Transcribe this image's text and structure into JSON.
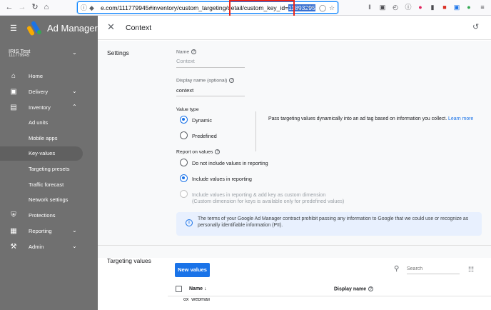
{
  "browser": {
    "url_prefix": "e.com/111779945#inventory/custom_targeting/detail/",
    "url_highlight_a": "custom_key_id=",
    "url_highlight_b": "11893295",
    "colors": {
      "highlight_box": "#e8251c",
      "selection": "#3a71d1"
    }
  },
  "sidebar": {
    "brand": "Ad Manager",
    "network_name": "IRIS Test",
    "network_id": "111779945",
    "items": [
      {
        "label": "Home",
        "icon": "home-icon"
      },
      {
        "label": "Delivery",
        "icon": "delivery-icon"
      },
      {
        "label": "Inventory",
        "icon": "inventory-icon"
      },
      {
        "label": "Ad units"
      },
      {
        "label": "Mobile apps"
      },
      {
        "label": "Key-values"
      },
      {
        "label": "Targeting presets"
      },
      {
        "label": "Traffic forecast"
      },
      {
        "label": "Network settings"
      },
      {
        "label": "Protections",
        "icon": "shield-icon"
      },
      {
        "label": "Reporting",
        "icon": "reporting-icon"
      },
      {
        "label": "Admin",
        "icon": "wrench-icon"
      }
    ]
  },
  "panel": {
    "title": "Context",
    "settings_title": "Settings",
    "name_label": "Name",
    "name_value": "Context",
    "display_label": "Display name (optional)",
    "display_value": "context",
    "value_type_label": "Value type",
    "value_type_options": [
      "Dynamic",
      "Predefined"
    ],
    "value_type_desc": "Pass targeting values dynamically into an ad tag based on information you collect.",
    "learn_more": "Learn more",
    "report_label": "Report on values",
    "report_options": [
      "Do not include values in reporting",
      "Include values in reporting",
      "Include values in reporting & add key as custom dimension",
      "(Custom dimension for keys is available only for predefined values)"
    ],
    "info_text": "The terms of your Google Ad Manager contract prohibit passing any information to Google that we could use or recognize as personally identifiable information (PII).",
    "targeting_title": "Targeting values",
    "new_values": "New values",
    "search_placeholder": "Search",
    "col_name": "Name",
    "col_display": "Display name",
    "row_peek": "ox_webmail"
  },
  "colors": {
    "accent": "#1a73e8",
    "sidebar": "#707070",
    "info_bg": "#e8f0fe"
  }
}
